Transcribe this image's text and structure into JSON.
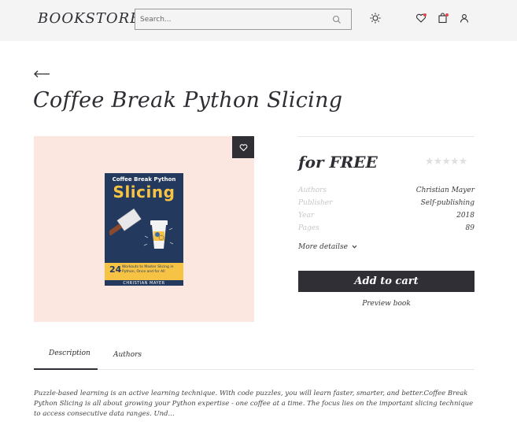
{
  "header": {
    "logo": "BOOKSTORE",
    "search_placeholder": "Search...",
    "icons": [
      "search-icon",
      "sun-icon",
      "heart-icon",
      "cart-icon",
      "user-icon"
    ],
    "accent_color": "#e04a4a"
  },
  "book": {
    "title": "Coffee Break Python Slicing",
    "price": "for FREE",
    "rating": 0,
    "rating_max": 5,
    "cover": {
      "line1": "Coffee Break Python",
      "line2": "Slicing",
      "number": "24",
      "subtitle": "Workouts to Master Slicing in Python, Once and for All",
      "author": "CHRISTIAN MAYER",
      "bg_color": "#233a5e",
      "accent_color": "#f6c344"
    },
    "meta": [
      {
        "key": "Authors",
        "value": "Christian Mayer"
      },
      {
        "key": "Publisher",
        "value": "Self-publishing"
      },
      {
        "key": "Year",
        "value": "2018"
      },
      {
        "key": "Pages",
        "value": "89"
      }
    ],
    "more_details": "More detailse",
    "add_to_cart": "Add to cart",
    "preview": "Preview book"
  },
  "tabs": [
    {
      "label": "Description",
      "active": true
    },
    {
      "label": "Authors",
      "active": false
    }
  ],
  "description": "Puzzle-based learning is an active learning technique. With code puzzles, you will learn faster, smarter, and better.Coffee Break Python Slicing is all about growing your Python expertise - one coffee at a time. The focus lies on the important slicing technique to access consecutive data ranges. Und..."
}
